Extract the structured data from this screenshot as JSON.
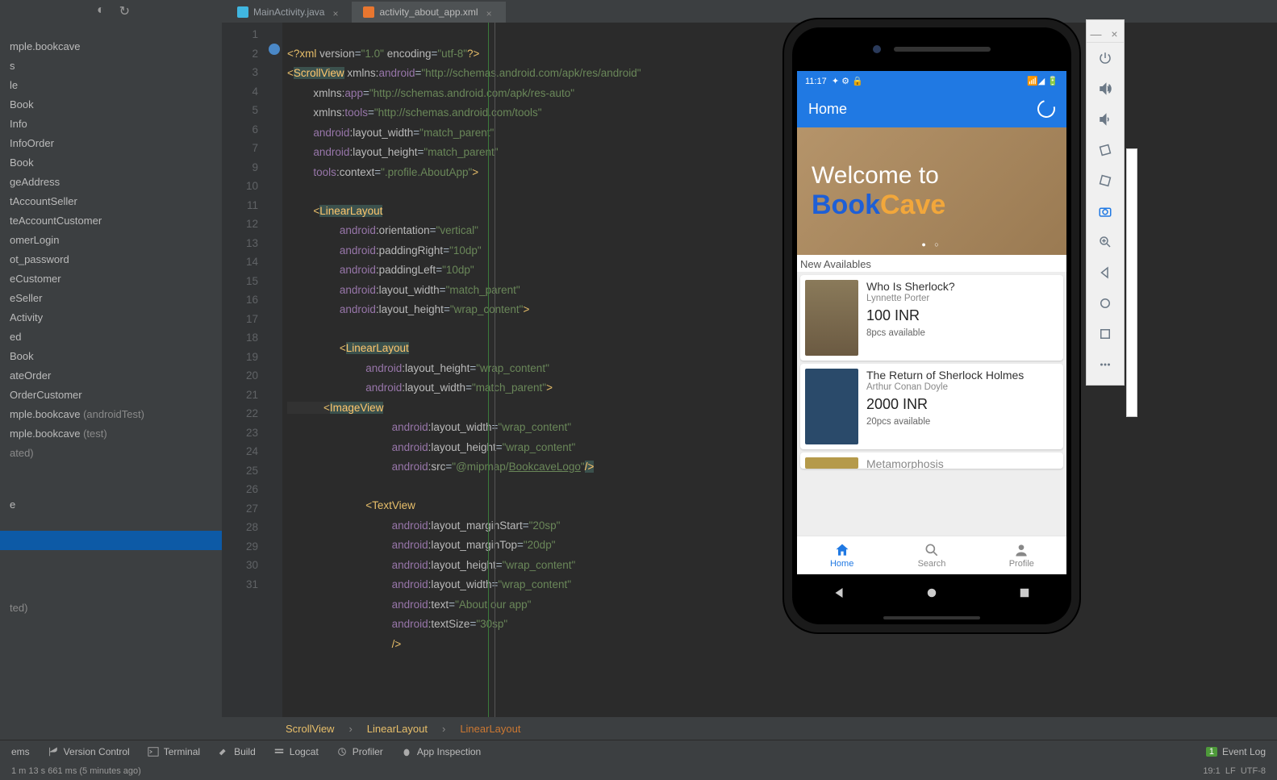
{
  "tabs": {
    "t1": "MainActivity.java",
    "t2": "activity_about_app.xml"
  },
  "project": {
    "items": [
      "mple.bookcave",
      "s",
      "le",
      "Book",
      "Info",
      "InfoOrder",
      "Book",
      "geAddress",
      "tAccountSeller",
      "teAccountCustomer",
      "omerLogin",
      "ot_password",
      "eCustomer",
      "eSeller",
      "Activity",
      "ed",
      "Book",
      "ateOrder",
      "OrderCustomer"
    ],
    "pkg1": "mple.bookcave",
    "pkg1_note": "(androidTest)",
    "pkg2": "mple.bookcave",
    "pkg2_note": "(test)",
    "gen": "ated)",
    "e": "e",
    "tedp": "ted)"
  },
  "code": {
    "l1a": "<?",
    "l1b": "xml",
    "l1c": " version",
    "l1d": "=",
    "l1e": "\"1.0\"",
    "l1f": " encoding",
    "l1g": "=",
    "l1h": "\"utf-8\"",
    "l1i": "?>",
    "l2a": "<",
    "l2tag": "ScrollView",
    "l2b": " xmlns:",
    "l2c": "android",
    "l2d": "=",
    "l2e": "\"http://schemas.android.com/apk/res/android\"",
    "l3a": "xmlns:",
    "l3b": "app",
    "l3c": "=",
    "l3d": "\"http://schemas.android.com/apk/res-auto\"",
    "l4a": "xmlns:",
    "l4b": "tools",
    "l4c": "=",
    "l4d": "\"http://schemas.android.com/tools\"",
    "l5a": "android",
    "l5b": ":layout_width",
    "l5c": "=",
    "l5d": "\"match_parent\"",
    "l6a": "android",
    "l6b": ":layout_height",
    "l6c": "=",
    "l6d": "\"match_parent\"",
    "l7a": "tools",
    "l7b": ":context",
    "l7c": "=",
    "l7d": "\".profile.AboutApp\"",
    "l7e": ">",
    "l9a": "<",
    "l9tag": "LinearLayout",
    "l10a": "android",
    "l10b": ":orientation",
    "l10c": "=",
    "l10d": "\"vertical\"",
    "l11a": "android",
    "l11b": ":paddingRight",
    "l11c": "=",
    "l11d": "\"10dp\"",
    "l12a": "android",
    "l12b": ":paddingLeft",
    "l12c": "=",
    "l12d": "\"10dp\"",
    "l13a": "android",
    "l13b": ":layout_width",
    "l13c": "=",
    "l13d": "\"match_parent\"",
    "l14a": "android",
    "l14b": ":layout_height",
    "l14c": "=",
    "l14d": "\"wrap_content\"",
    "l14e": ">",
    "l16a": "<",
    "l16tag": "LinearLayout",
    "l17a": "android",
    "l17b": ":layout_height",
    "l17c": "=",
    "l17d": "\"wrap_content\"",
    "l18a": "android",
    "l18b": ":layout_width",
    "l18c": "=",
    "l18d": "\"match_parent\"",
    "l18e": ">",
    "l19a": "<",
    "l19tag": "ImageView",
    "l20a": "android",
    "l20b": ":layout_width",
    "l20c": "=",
    "l20d": "\"wrap_content\"",
    "l21a": "android",
    "l21b": ":layout_height",
    "l21c": "=",
    "l21d": "\"wrap_content\"",
    "l22a": "android",
    "l22b": ":src",
    "l22c": "=",
    "l22d": "\"@mipmap/",
    "l22d2": "BookcaveLogo",
    "l22d3": "\"",
    "l22e": "/>",
    "l24a": "<",
    "l24tag": "TextView",
    "l25a": "android",
    "l25b": ":layout_marginStart",
    "l25c": "=",
    "l25d": "\"20sp\"",
    "l26a": "android",
    "l26b": ":layout_marginTop",
    "l26c": "=",
    "l26d": "\"20dp\"",
    "l27a": "android",
    "l27b": ":layout_height",
    "l27c": "=",
    "l27d": "\"wrap_content\"",
    "l28a": "android",
    "l28b": ":layout_width",
    "l28c": "=",
    "l28d": "\"wrap_content\"",
    "l29a": "android",
    "l29b": ":text",
    "l29c": "=",
    "l29d": "\"About our app\"",
    "l30a": "android",
    "l30b": ":textSize",
    "l30c": "=",
    "l30d": "\"30sp\"",
    "l31a": "/>",
    "nums": [
      "1",
      "2",
      "3",
      "4",
      "5",
      "6",
      "7",
      "",
      "9",
      "10",
      "11",
      "12",
      "13",
      "14",
      "15",
      "16",
      "17",
      "18",
      "19",
      "20",
      "21",
      "22",
      "23",
      "24",
      "25",
      "26",
      "27",
      "28",
      "29",
      "30",
      "31"
    ]
  },
  "crumbs": {
    "c1": "ScrollView",
    "c2": "LinearLayout",
    "c3": "LinearLayout"
  },
  "bottom": {
    "problems": "ems",
    "vcs": "Version Control",
    "term": "Terminal",
    "build": "Build",
    "logcat": "Logcat",
    "profiler": "Profiler",
    "appinsp": "App Inspection",
    "event": "Event Log",
    "evn": "1"
  },
  "status": {
    "left": "1 m 13 s 661 ms (5 minutes ago)",
    "pos": "19:1",
    "lf": "LF",
    "enc": "UTF-8"
  },
  "emu": {
    "time": "11:17",
    "sicons": "✦ ⚙ 🔒",
    "sig": "📶◢ 🔋",
    "title": "Home",
    "banner1": "Welcome to",
    "bannerB": "Book",
    "bannerC": "Cave",
    "section": "New Availables",
    "b1t": "Who Is Sherlock?",
    "b1a": "Lynnette Porter",
    "b1p": "100 INR",
    "b1s": "8pcs available",
    "b2t": "The Return of Sherlock Holmes",
    "b2a": "Arthur Conan Doyle",
    "b2p": "2000 INR",
    "b2s": "20pcs available",
    "b3t": "Metamorphosis",
    "nav1": "Home",
    "nav2": "Search",
    "nav3": "Profile"
  }
}
